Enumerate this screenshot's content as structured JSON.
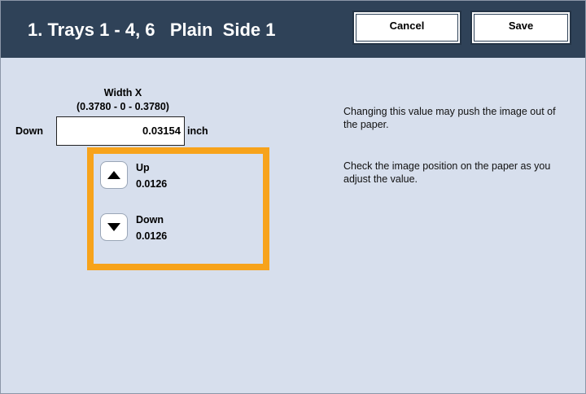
{
  "header": {
    "title": "1. Trays 1 - 4, 6   Plain  Side 1",
    "cancel_label": "Cancel",
    "save_label": "Save"
  },
  "adjust": {
    "heading": "Width X",
    "range": "(0.3780 - 0 -  0.3780)",
    "direction_label": "Down",
    "value": "0.03154",
    "unit": "inch"
  },
  "stepper": {
    "up_label": "Up",
    "up_increment": "0.0126",
    "down_label": "Down",
    "down_increment": "0.0126",
    "highlight_color": "#f7a31b"
  },
  "messages": [
    "Changing this value may push the image out of the paper.",
    "Check the image position on the paper as you adjust the value."
  ],
  "colors": {
    "header_bg": "#2f4258",
    "screen_bg": "#d7dfed"
  }
}
